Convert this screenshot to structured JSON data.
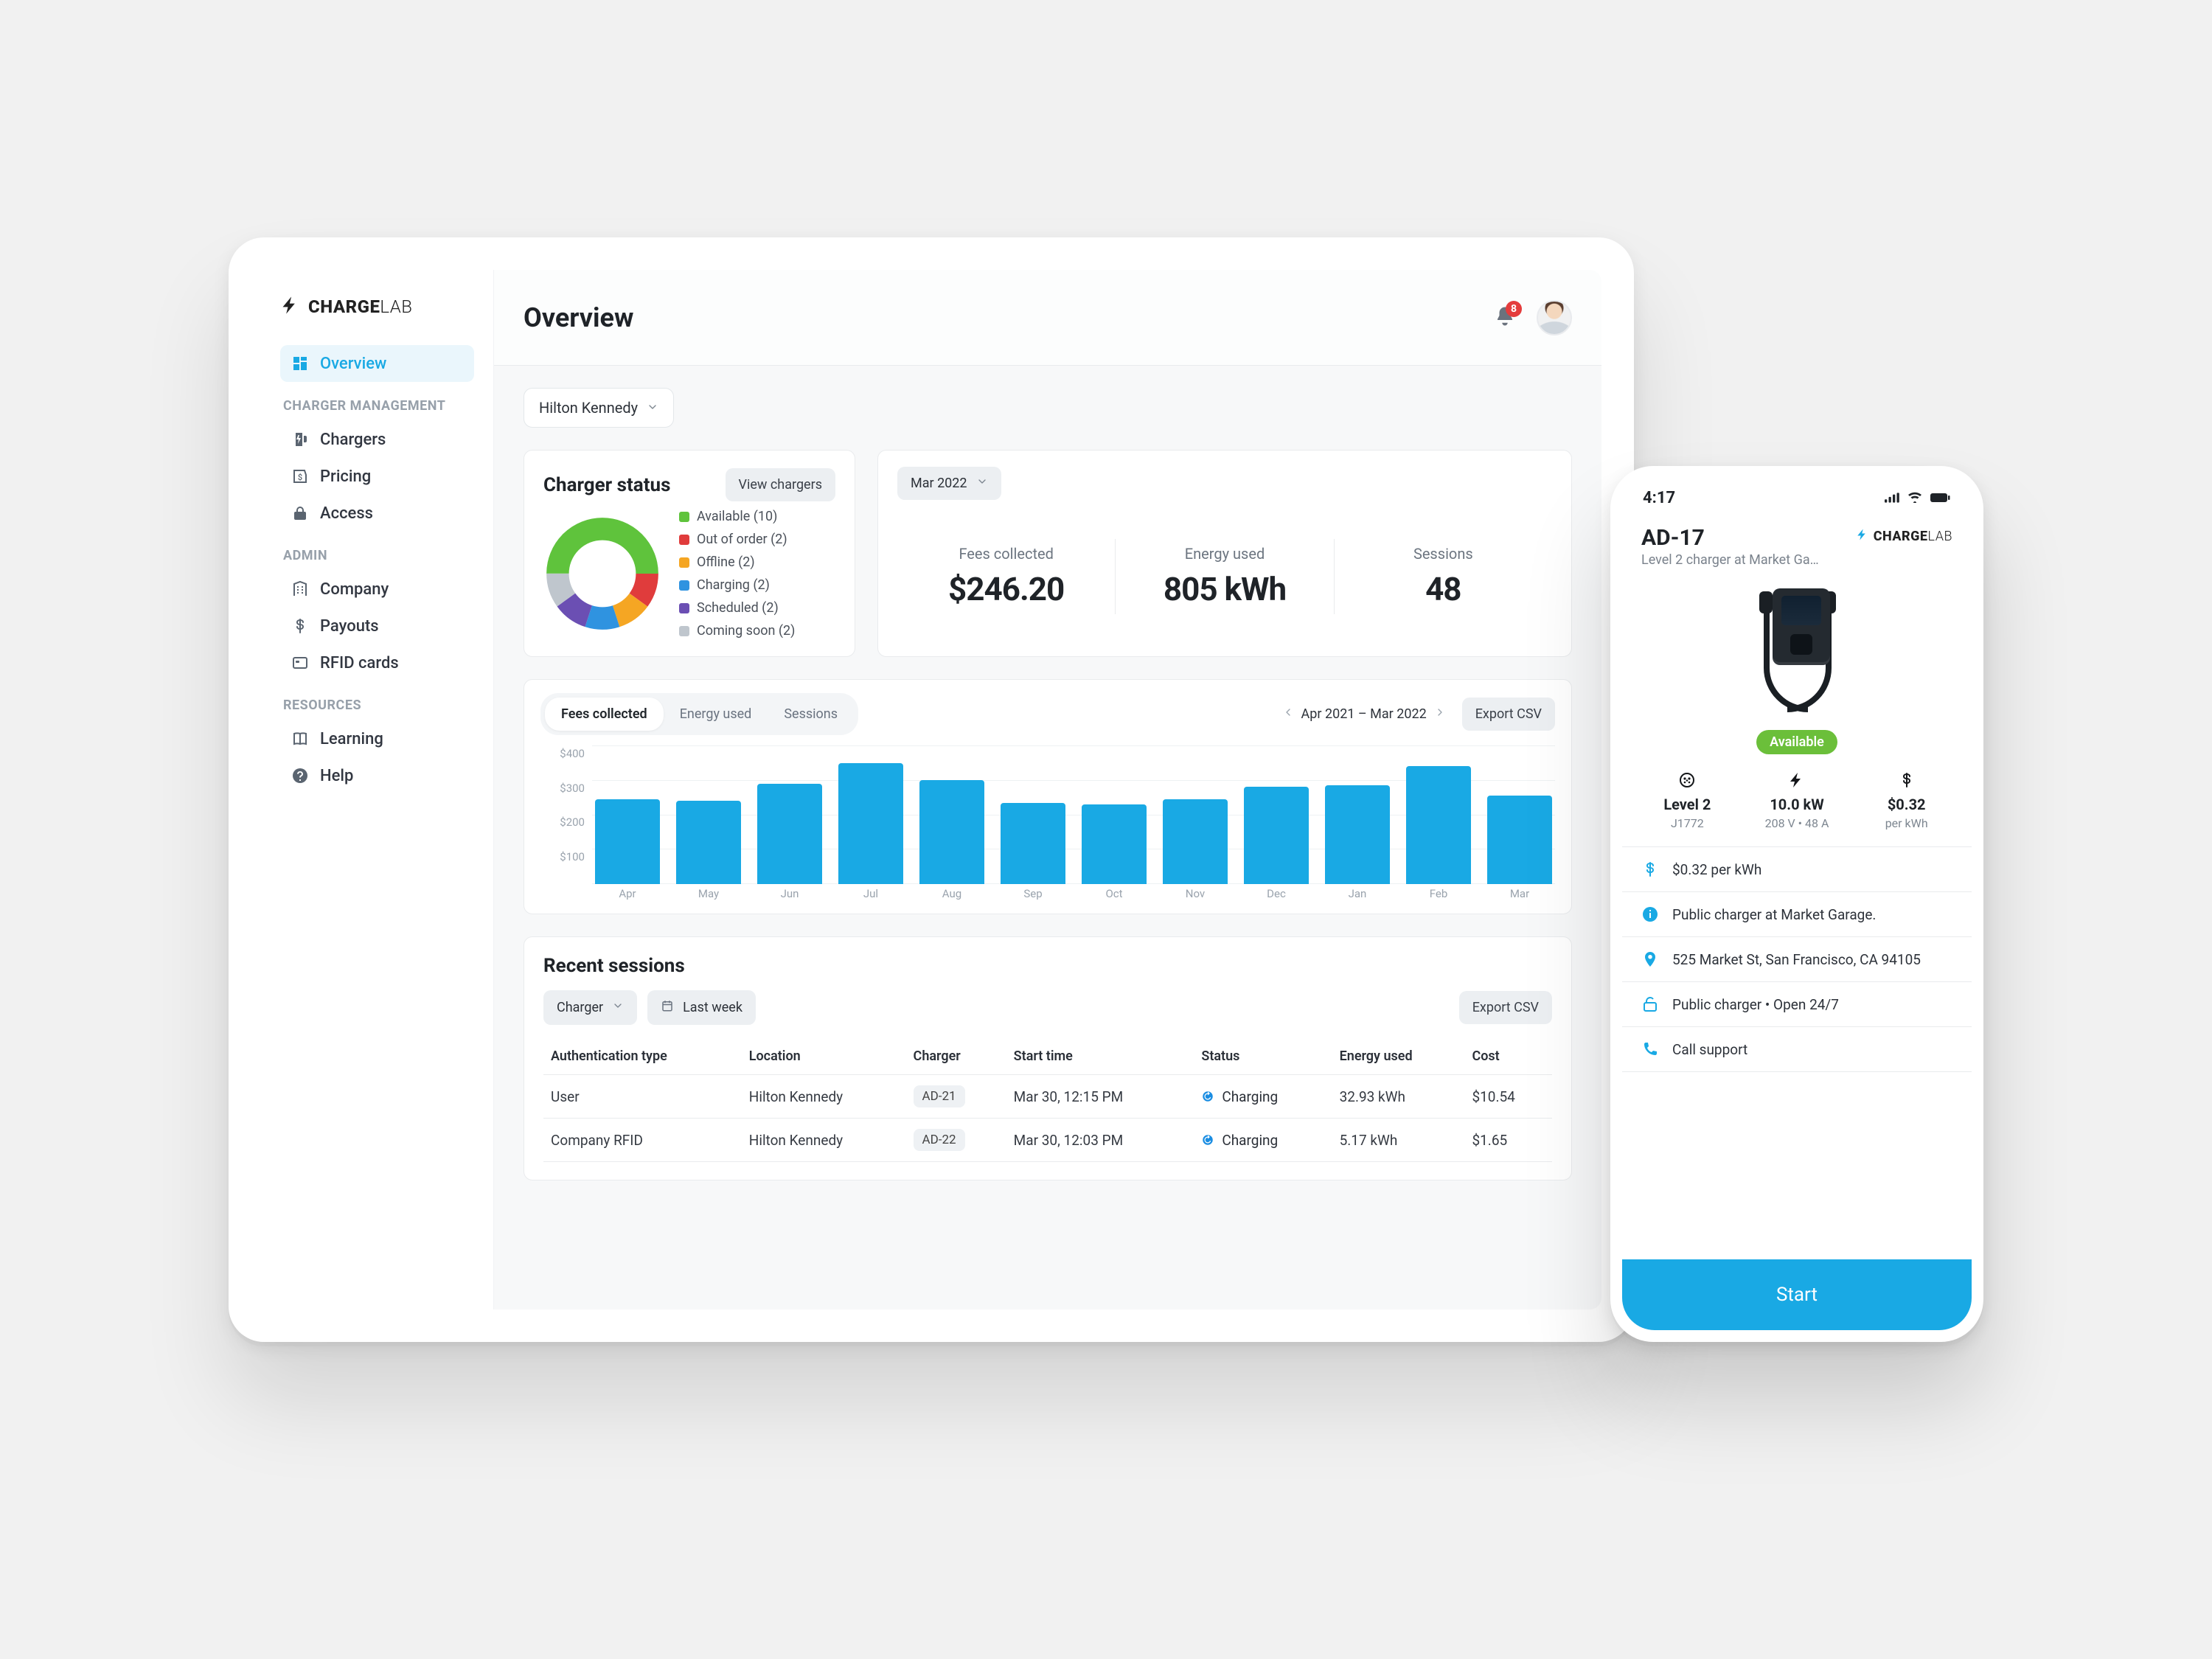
{
  "brand": {
    "name1": "CHARGE",
    "name2": "LAB"
  },
  "sidebar": {
    "sections": [
      {
        "label": "",
        "items": [
          {
            "key": "overview",
            "label": "Overview",
            "icon": "dashboard-icon",
            "active": true
          }
        ]
      },
      {
        "label": "CHARGER MANAGEMENT",
        "items": [
          {
            "key": "chargers",
            "label": "Chargers",
            "icon": "charger-icon"
          },
          {
            "key": "pricing",
            "label": "Pricing",
            "icon": "pricing-icon"
          },
          {
            "key": "access",
            "label": "Access",
            "icon": "lock-icon"
          }
        ]
      },
      {
        "label": "ADMIN",
        "items": [
          {
            "key": "company",
            "label": "Company",
            "icon": "building-icon"
          },
          {
            "key": "payouts",
            "label": "Payouts",
            "icon": "dollar-icon"
          },
          {
            "key": "rfid",
            "label": "RFID cards",
            "icon": "card-icon"
          }
        ]
      },
      {
        "label": "RESOURCES",
        "items": [
          {
            "key": "learning",
            "label": "Learning",
            "icon": "book-icon"
          },
          {
            "key": "help",
            "label": "Help",
            "icon": "help-icon"
          }
        ]
      }
    ]
  },
  "header": {
    "title": "Overview",
    "notification_count": "8"
  },
  "location_select": {
    "value": "Hilton Kennedy"
  },
  "status": {
    "title": "Charger status",
    "view_label": "View chargers",
    "legend": [
      {
        "label": "Available (10)",
        "color": "#5fc33c",
        "count": 10
      },
      {
        "label": "Out of order (2)",
        "color": "#e03c3c",
        "count": 2
      },
      {
        "label": "Offline (2)",
        "color": "#f5a623",
        "count": 2
      },
      {
        "label": "Charging (2)",
        "color": "#2f93e0",
        "count": 2
      },
      {
        "label": "Scheduled (2)",
        "color": "#6b4fb3",
        "count": 2
      },
      {
        "label": "Coming soon (2)",
        "color": "#bfc6cd",
        "count": 2
      }
    ]
  },
  "metrics": {
    "period_label": "Mar 2022",
    "items": [
      {
        "label": "Fees collected",
        "value": "$246.20"
      },
      {
        "label": "Energy used",
        "value": "805 kWh"
      },
      {
        "label": "Sessions",
        "value": "48"
      }
    ]
  },
  "chart": {
    "tabs": [
      "Fees collected",
      "Energy used",
      "Sessions"
    ],
    "active_tab": 0,
    "range": "Apr 2021 – Mar 2022",
    "export_label": "Export CSV"
  },
  "chart_data": {
    "type": "bar",
    "title": "Fees collected",
    "xlabel": "",
    "ylabel": "",
    "ylim": [
      0,
      400
    ],
    "y_ticks": [
      "$400",
      "$300",
      "$200",
      "$100",
      ""
    ],
    "categories": [
      "Apr",
      "May",
      "Jun",
      "Jul",
      "Aug",
      "Sep",
      "Oct",
      "Nov",
      "Dec",
      "Jan",
      "Feb",
      "Mar"
    ],
    "values": [
      245,
      240,
      290,
      350,
      300,
      235,
      230,
      245,
      280,
      285,
      340,
      255
    ]
  },
  "sessions": {
    "title": "Recent sessions",
    "filters": {
      "charger": "Charger",
      "period": "Last week",
      "export": "Export CSV"
    },
    "columns": [
      "Authentication type",
      "Location",
      "Charger",
      "Start time",
      "Status",
      "Energy used",
      "Cost"
    ],
    "rows": [
      {
        "auth": "User",
        "location": "Hilton Kennedy",
        "charger": "AD-21",
        "start": "Mar 30, 12:15 PM",
        "status": "Charging",
        "energy": "32.93 kWh",
        "cost": "$10.54"
      },
      {
        "auth": "Company RFID",
        "location": "Hilton Kennedy",
        "charger": "AD-22",
        "start": "Mar 30, 12:03 PM",
        "status": "Charging",
        "energy": "5.17 kWh",
        "cost": "$1.65"
      }
    ]
  },
  "phone": {
    "statusbar": {
      "time": "4:17"
    },
    "title": "AD-17",
    "subtitle": "Level 2 charger at Market Ga…",
    "badge": "Available",
    "specs": [
      {
        "icon": "plug-icon",
        "v1": "Level 2",
        "v2": "J1772"
      },
      {
        "icon": "bolt-icon",
        "v1": "10.0 kW",
        "v2": "208 V • 48 A"
      },
      {
        "icon": "dollar-icon",
        "v1": "$0.32",
        "v2": "per kWh"
      }
    ],
    "info": [
      {
        "icon": "dollar-icon",
        "text": "$0.32 per kWh"
      },
      {
        "icon": "info-icon",
        "text": "Public charger at Market Garage."
      },
      {
        "icon": "pin-icon",
        "text": "525 Market St, San Francisco, CA 94105"
      },
      {
        "icon": "unlock-icon",
        "text": "Public charger • Open 24/7"
      },
      {
        "icon": "phone-icon",
        "text": "Call support"
      }
    ],
    "start_label": "Start"
  }
}
